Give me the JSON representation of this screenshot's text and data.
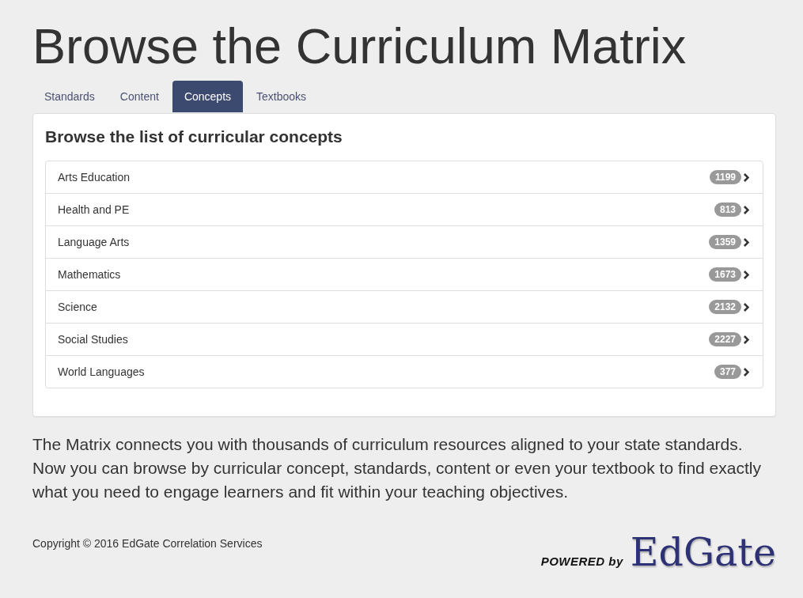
{
  "page_title": "Browse the Curriculum Matrix",
  "tabs": [
    {
      "label": "Standards",
      "selected": false
    },
    {
      "label": "Content",
      "selected": false
    },
    {
      "label": "Concepts",
      "selected": true
    },
    {
      "label": "Textbooks",
      "selected": false
    }
  ],
  "panel": {
    "heading": "Browse the list of curricular concepts",
    "items": [
      {
        "label": "Arts Education",
        "count": "1199"
      },
      {
        "label": "Health and PE",
        "count": "813"
      },
      {
        "label": "Language Arts",
        "count": "1359"
      },
      {
        "label": "Mathematics",
        "count": "1673"
      },
      {
        "label": "Science",
        "count": "2132"
      },
      {
        "label": "Social Studies",
        "count": "2227"
      },
      {
        "label": "World Languages",
        "count": "377"
      }
    ]
  },
  "description": "The Matrix connects you with thousands of curriculum resources aligned to your state standards. Now you can browse by curricular concept, standards, content or even your textbook to find exactly what you need to engage learners and fit within your teaching objectives.",
  "footer": {
    "copyright": "Copyright © 2016 EdGate Correlation Services",
    "logo": {
      "prefix": "POWERED by",
      "name": "EdGate"
    }
  }
}
